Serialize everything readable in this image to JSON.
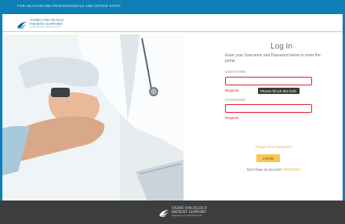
{
  "topbar": {
    "audience_text": "FOR HEALTHCARE PROFESSIONALS AND OFFICE STAFF"
  },
  "brand": {
    "line1": "TAIHO ONCOLOGY",
    "line2": "PATIENT SUPPORT",
    "tagline": "Supporting your treatment journey",
    "logo_icon": "taiho-swoosh-logo",
    "colors": {
      "primary": "#0d7fb5",
      "accent": "#f5c84e",
      "error": "#e21f2d",
      "footer": "#3d3d3d"
    }
  },
  "login": {
    "heading": "Log In",
    "intro": "Enter your Username and Password below to enter the portal.",
    "username": {
      "label": "USERNAME",
      "value": "",
      "required_text": "Required"
    },
    "password": {
      "label": "PASSWORD",
      "value": "",
      "required_text": "Required"
    },
    "tooltip": "Please fill out this field.",
    "forgot_link": "Forgot Your Password?",
    "submit_label": "LOGIN",
    "register_prompt": "Don't have an account?",
    "register_link": "REGISTER"
  },
  "footer": {
    "line1": "TAIHO ONCOLOGY",
    "line2": "PATIENT SUPPORT",
    "tagline": "Supporting your treatment journey"
  }
}
